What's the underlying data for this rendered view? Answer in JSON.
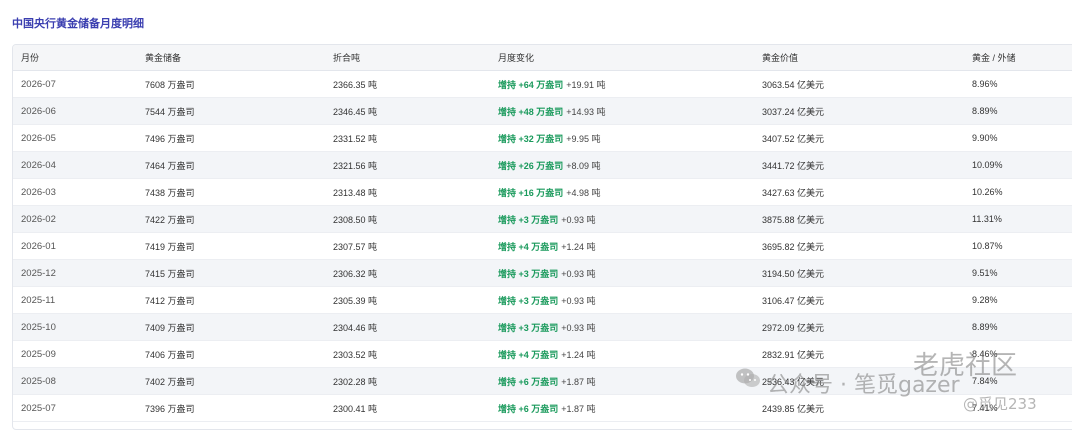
{
  "page": {
    "title": "中国央行黄金储备月度明细"
  },
  "table": {
    "headers": [
      "月份",
      "黄金储备",
      "折合吨",
      "月度变化",
      "黄金价值",
      "黄金 / 外储"
    ],
    "rows": [
      {
        "month": "2026-07",
        "reserve": "7608 万盎司",
        "tons": "2366.35 吨",
        "change": "增持 +64 万盎司",
        "delta": "+19.91 吨",
        "value": "3063.54 亿美元",
        "ratio": "8.96%"
      },
      {
        "month": "2026-06",
        "reserve": "7544 万盎司",
        "tons": "2346.45 吨",
        "change": "增持 +48 万盎司",
        "delta": "+14.93 吨",
        "value": "3037.24 亿美元",
        "ratio": "8.89%"
      },
      {
        "month": "2026-05",
        "reserve": "7496 万盎司",
        "tons": "2331.52 吨",
        "change": "增持 +32 万盎司",
        "delta": "+9.95 吨",
        "value": "3407.52 亿美元",
        "ratio": "9.90%"
      },
      {
        "month": "2026-04",
        "reserve": "7464 万盎司",
        "tons": "2321.56 吨",
        "change": "增持 +26 万盎司",
        "delta": "+8.09 吨",
        "value": "3441.72 亿美元",
        "ratio": "10.09%"
      },
      {
        "month": "2026-03",
        "reserve": "7438 万盎司",
        "tons": "2313.48 吨",
        "change": "增持 +16 万盎司",
        "delta": "+4.98 吨",
        "value": "3427.63 亿美元",
        "ratio": "10.26%"
      },
      {
        "month": "2026-02",
        "reserve": "7422 万盎司",
        "tons": "2308.50 吨",
        "change": "增持 +3 万盎司",
        "delta": "+0.93 吨",
        "value": "3875.88 亿美元",
        "ratio": "11.31%"
      },
      {
        "month": "2026-01",
        "reserve": "7419 万盎司",
        "tons": "2307.57 吨",
        "change": "增持 +4 万盎司",
        "delta": "+1.24 吨",
        "value": "3695.82 亿美元",
        "ratio": "10.87%"
      },
      {
        "month": "2025-12",
        "reserve": "7415 万盎司",
        "tons": "2306.32 吨",
        "change": "增持 +3 万盎司",
        "delta": "+0.93 吨",
        "value": "3194.50 亿美元",
        "ratio": "9.51%"
      },
      {
        "month": "2025-11",
        "reserve": "7412 万盎司",
        "tons": "2305.39 吨",
        "change": "增持 +3 万盎司",
        "delta": "+0.93 吨",
        "value": "3106.47 亿美元",
        "ratio": "9.28%"
      },
      {
        "month": "2025-10",
        "reserve": "7409 万盎司",
        "tons": "2304.46 吨",
        "change": "增持 +3 万盎司",
        "delta": "+0.93 吨",
        "value": "2972.09 亿美元",
        "ratio": "8.89%"
      },
      {
        "month": "2025-09",
        "reserve": "7406 万盎司",
        "tons": "2303.52 吨",
        "change": "增持 +4 万盎司",
        "delta": "+1.24 吨",
        "value": "2832.91 亿美元",
        "ratio": "8.46%"
      },
      {
        "month": "2025-08",
        "reserve": "7402 万盎司",
        "tons": "2302.28 吨",
        "change": "增持 +6 万盎司",
        "delta": "+1.87 吨",
        "value": "2536.43 亿美元",
        "ratio": "7.84%"
      },
      {
        "month": "2025-07",
        "reserve": "7396 万盎司",
        "tons": "2300.41 吨",
        "change": "增持 +6 万盎司",
        "delta": "+1.87 吨",
        "value": "2439.85 亿美元",
        "ratio": "7.41%"
      }
    ]
  },
  "watermark": {
    "brand": "老虎社区",
    "account": "公众号 · 笔觅gazer",
    "handle": "@觅见233",
    "icon": "wechat-icon"
  },
  "colors": {
    "title": "#3b3fb0",
    "increase": "#1a9a5c"
  }
}
